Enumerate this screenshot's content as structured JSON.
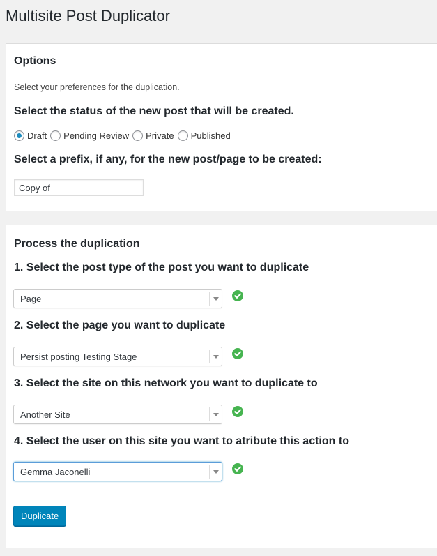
{
  "page": {
    "title": "Multisite Post Duplicator"
  },
  "options": {
    "heading": "Options",
    "description": "Select your preferences for the duplication.",
    "status_question": "Select the status of the new post that will be created.",
    "statuses": [
      {
        "label": "Draft",
        "checked": true
      },
      {
        "label": "Pending Review",
        "checked": false
      },
      {
        "label": "Private",
        "checked": false
      },
      {
        "label": "Published",
        "checked": false
      }
    ],
    "prefix_question": "Select a prefix, if any, for the new post/page to be created:",
    "prefix_value": "Copy of"
  },
  "process": {
    "heading": "Process the duplication",
    "steps": [
      {
        "question": "1. Select the post type of the post you want to duplicate",
        "selected": "Page"
      },
      {
        "question": "2. Select the page you want to duplicate",
        "selected": "Persist posting Testing Stage"
      },
      {
        "question": "3. Select the site on this network you want to duplicate to",
        "selected": "Another Site"
      },
      {
        "question": "4. Select the user on this site you want to atribute this action to",
        "selected": "Gemma Jaconelli"
      }
    ],
    "button_label": "Duplicate"
  },
  "colors": {
    "accent": "#0085ba",
    "radio_checked": "#1e8cbe",
    "check_green": "#46b450",
    "background": "#f1f1f1"
  },
  "icons": {
    "step_status": "check-circle-icon"
  }
}
